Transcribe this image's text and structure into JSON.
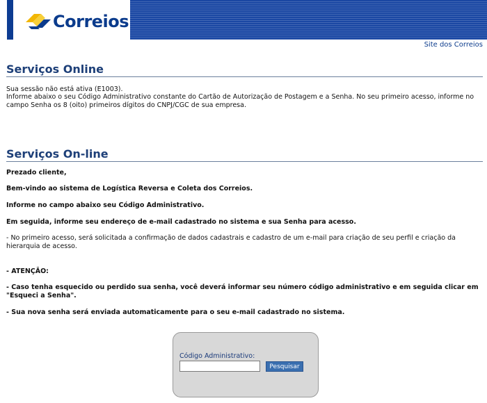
{
  "header": {
    "logo_text": "Correios",
    "site_link": "Site dos Correios"
  },
  "section1": {
    "title": "Serviços Online",
    "error": "Sua sessão não está ativa (E1003).",
    "info": "Informe abaixo o seu Código Administrativo constante do Cartão de Autorização de Postagem e a Senha. No seu primeiro acesso, informe no campo Senha os 8 (oito) primeiros dígitos do CNPJ/CGC de sua empresa."
  },
  "section2": {
    "title": "Serviços On-line",
    "greeting": "Prezado cliente,",
    "welcome": "Bem-vindo ao sistema de Logística Reversa e Coleta dos Correios.",
    "inform": "Informe no campo abaixo seu Código Administrativo.",
    "next": "Em seguida, informe seu endereço de e-mail cadastrado no sistema e sua Senha para acesso.",
    "first_access": "- No primeiro acesso, será solicitada a confirmação de dados cadastrais e cadastro de um e-mail para criação de seu perfil e criação da hierarquia de acesso.",
    "attention": "- ATENÇÃO:",
    "forgot": "- Caso tenha esquecido ou perdido sua senha, você deverá informar seu número código administrativo e em seguida clicar em \"Esqueci a Senha\".",
    "new_password": "- Sua nova senha será enviada automaticamente para o seu e-mail cadastrado no sistema."
  },
  "login": {
    "label": "Código Administrativo:",
    "input_value": "",
    "button_label": "Pesquisar"
  }
}
